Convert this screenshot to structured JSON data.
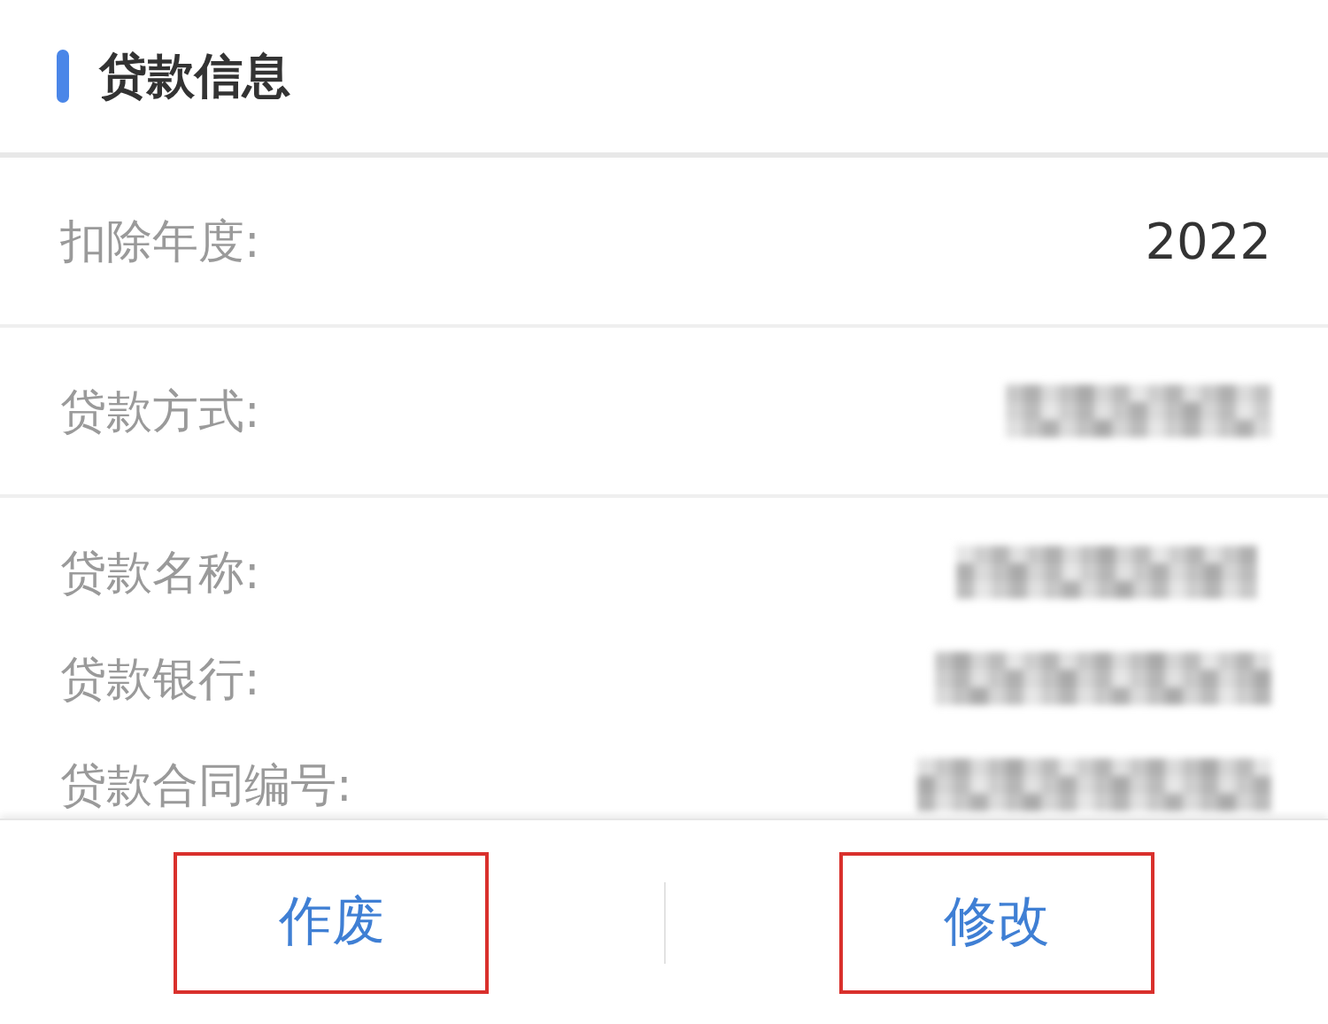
{
  "section": {
    "title": "贷款信息"
  },
  "rows": [
    {
      "label": "扣除年度:",
      "value": "2022",
      "kind": "divided",
      "blurred": false
    },
    {
      "label": "贷款方式:",
      "kind": "divided",
      "blurred": true
    },
    {
      "label": "贷款名称:",
      "kind": "compact",
      "blurred": true
    },
    {
      "label": "贷款银行:",
      "kind": "compact",
      "blurred": true
    },
    {
      "label": "贷款合同编号:",
      "kind": "compact",
      "blurred": true
    }
  ],
  "buttons": [
    {
      "label": "作废",
      "highlighted": true
    },
    {
      "label": "修改",
      "highlighted": true
    }
  ]
}
